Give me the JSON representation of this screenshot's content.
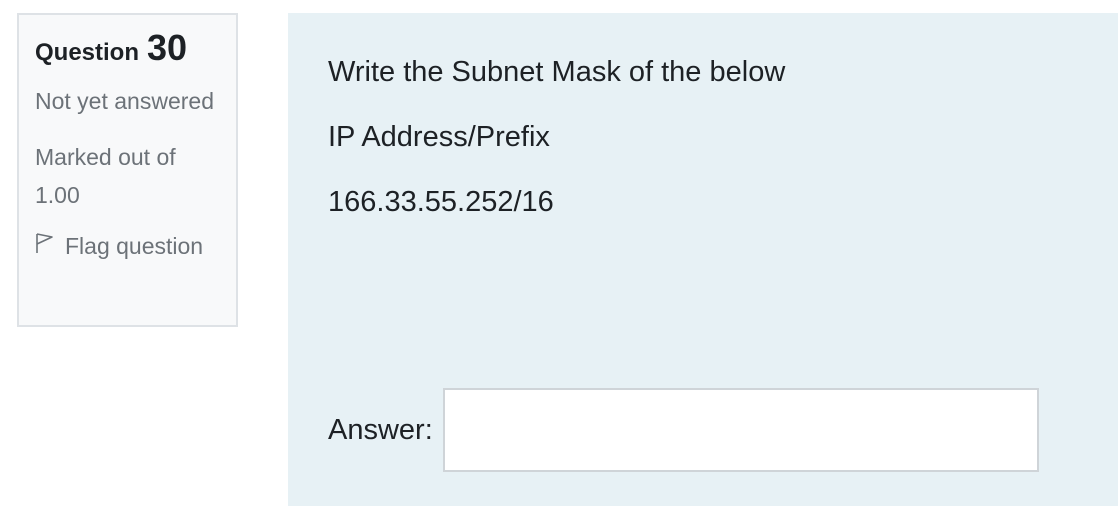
{
  "info": {
    "question_word": "Question",
    "question_number": "30",
    "status": "Not yet answered",
    "marks": "Marked out of 1.00",
    "flag_label": "Flag question"
  },
  "question": {
    "lines": [
      "Write the Subnet Mask of the below",
      "IP Address/Prefix",
      "166.33.55.252/16"
    ],
    "answer_label": "Answer:",
    "answer_value": ""
  },
  "colors": {
    "info_bg": "#f8f9fa",
    "info_border": "#dee2e6",
    "content_bg": "#e7f1f5",
    "text": "#1d2125",
    "muted_text": "#6c7278"
  }
}
